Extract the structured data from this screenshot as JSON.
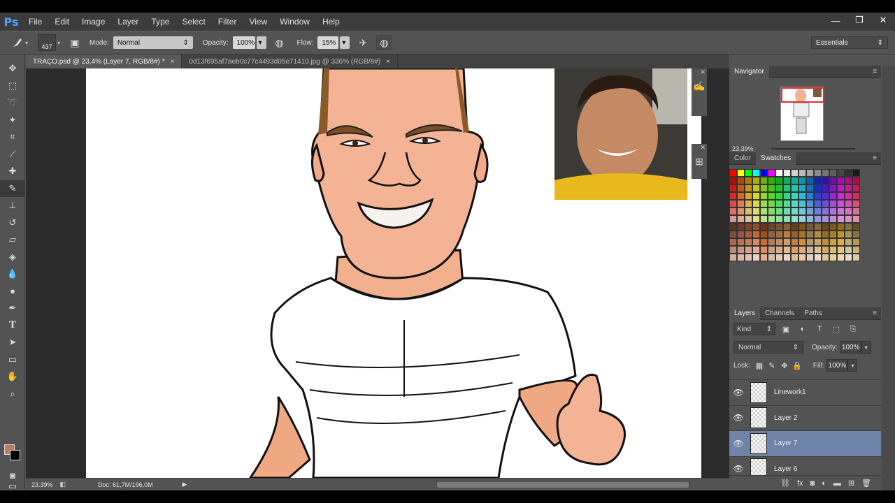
{
  "app": {
    "logo": "Ps"
  },
  "menu": [
    "File",
    "Edit",
    "Image",
    "Layer",
    "Type",
    "Select",
    "Filter",
    "View",
    "Window",
    "Help"
  ],
  "window_controls": {
    "minimize": "—",
    "restore": "❐",
    "close": "✕"
  },
  "options": {
    "brush_size": "437",
    "mode_label": "Mode:",
    "mode_value": "Normal",
    "opacity_label": "Opacity:",
    "opacity_value": "100%",
    "flow_label": "Flow:",
    "flow_value": "15%",
    "workspace": "Essentials"
  },
  "tabs": [
    {
      "label": "TRAÇO.psd @ 23,4% (Layer 7, RGB/8#) *",
      "close": "×"
    },
    {
      "label": "0d13f695af7aeb0c77c4493d05e71410.jpg @ 336% (RGB/8#)",
      "close": "×"
    }
  ],
  "status": {
    "zoom": "23.39%",
    "doc": "Doc: 61,7M/196,0M"
  },
  "navigator": {
    "title": "Navigator",
    "zoom": "23.39%"
  },
  "color_panel": {
    "tab_color": "Color",
    "tab_swatches": "Swatches"
  },
  "layers_panel": {
    "tab_layers": "Layers",
    "tab_channels": "Channels",
    "tab_paths": "Paths",
    "kind": "Kind",
    "blend": "Normal",
    "opacity_label": "Opacity:",
    "opacity_value": "100%",
    "lock_label": "Lock:",
    "fill_label": "Fill:",
    "fill_value": "100%",
    "layers": [
      {
        "name": "Linework1",
        "selected": false
      },
      {
        "name": "Layer 2",
        "selected": false
      },
      {
        "name": "Layer 7",
        "selected": true
      },
      {
        "name": "Layer 6",
        "selected": false
      }
    ]
  },
  "tools": [
    "move-icon",
    "marquee-icon",
    "lasso-icon",
    "magic-wand-icon",
    "crop-icon",
    "eyedropper-icon",
    "healing-brush-icon",
    "brush-icon",
    "stamp-icon",
    "history-brush-icon",
    "eraser-icon",
    "paint-bucket-icon",
    "blur-icon",
    "dodge-icon",
    "pen-icon",
    "type-icon",
    "path-select-icon",
    "rectangle-icon",
    "hand-icon",
    "zoom-icon"
  ],
  "colors": {
    "foreground": "#c07a5e",
    "background": "#000000",
    "selection": "#6f82a8"
  }
}
